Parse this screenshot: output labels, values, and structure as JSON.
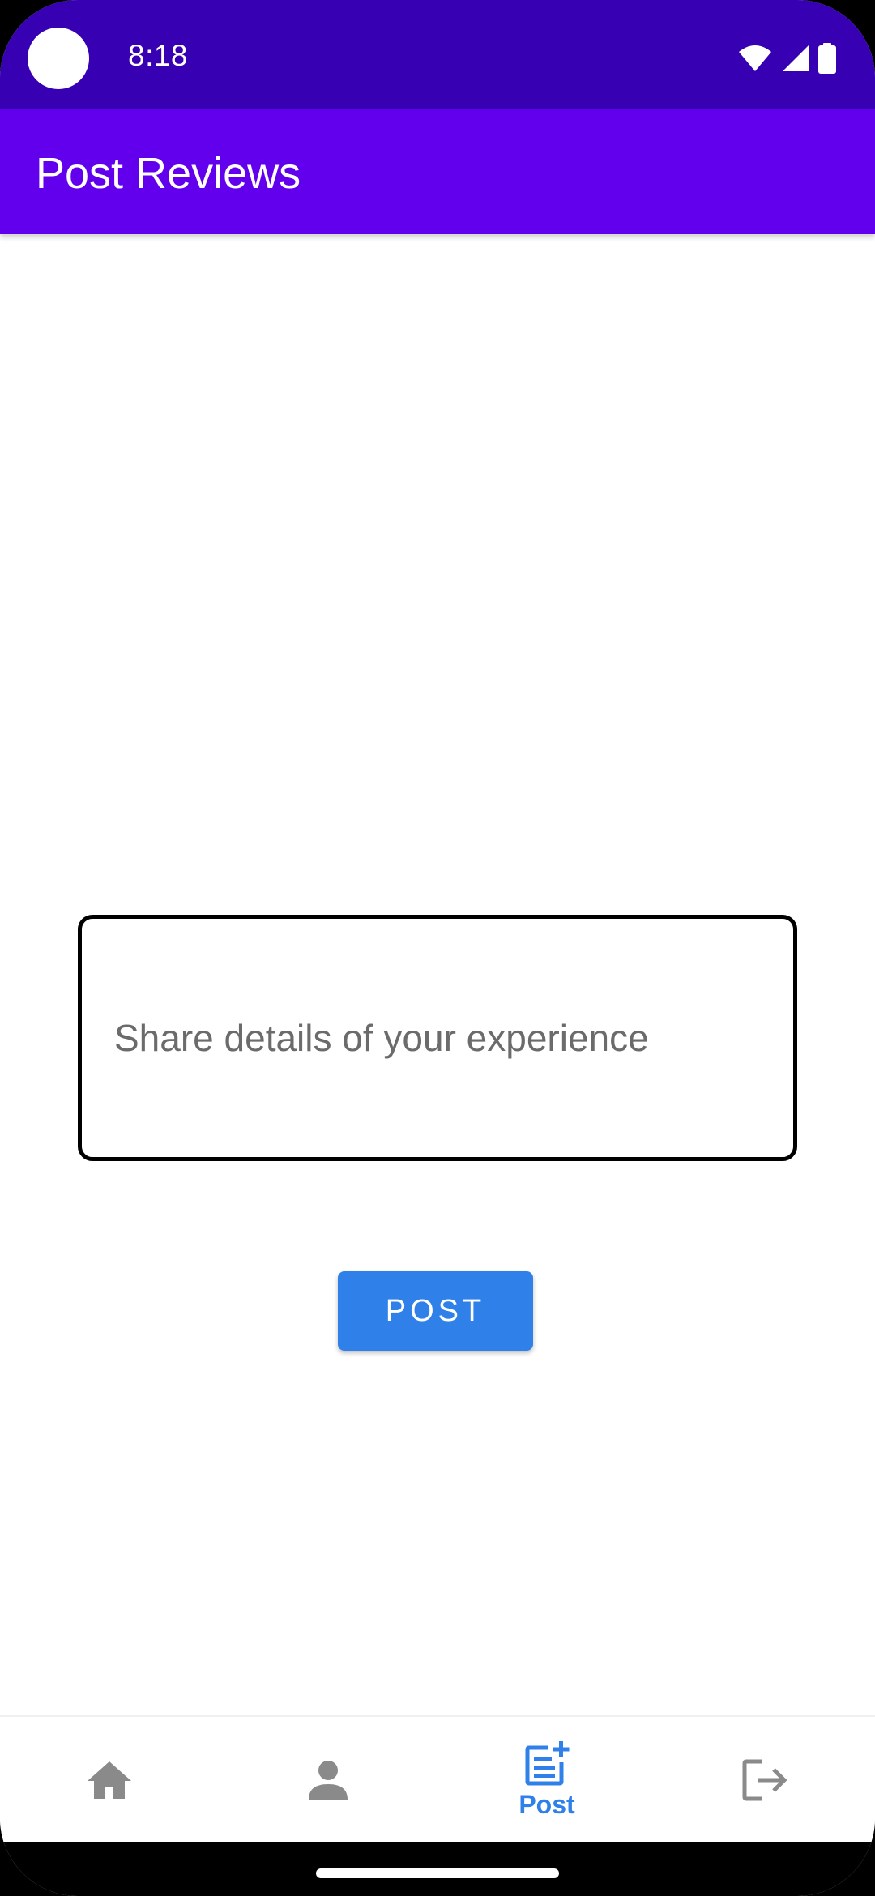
{
  "status_bar": {
    "time": "8:18",
    "icons": [
      "wifi-icon",
      "cell-signal-icon",
      "battery-icon"
    ]
  },
  "app_bar": {
    "title": "Post Reviews"
  },
  "review_form": {
    "placeholder": "Share details of your experience",
    "value": "",
    "post_label": "POST"
  },
  "bottom_nav": {
    "items": [
      {
        "icon": "home-icon",
        "label": "",
        "active": false
      },
      {
        "icon": "person-icon",
        "label": "",
        "active": false
      },
      {
        "icon": "post-add-icon",
        "label": "Post",
        "active": true
      },
      {
        "icon": "logout-icon",
        "label": "",
        "active": false
      }
    ]
  },
  "colors": {
    "status_bar": "#3700B3",
    "app_bar": "#6200EE",
    "accent": "#2F80E8",
    "inactive_icon": "#8a8a8a"
  }
}
